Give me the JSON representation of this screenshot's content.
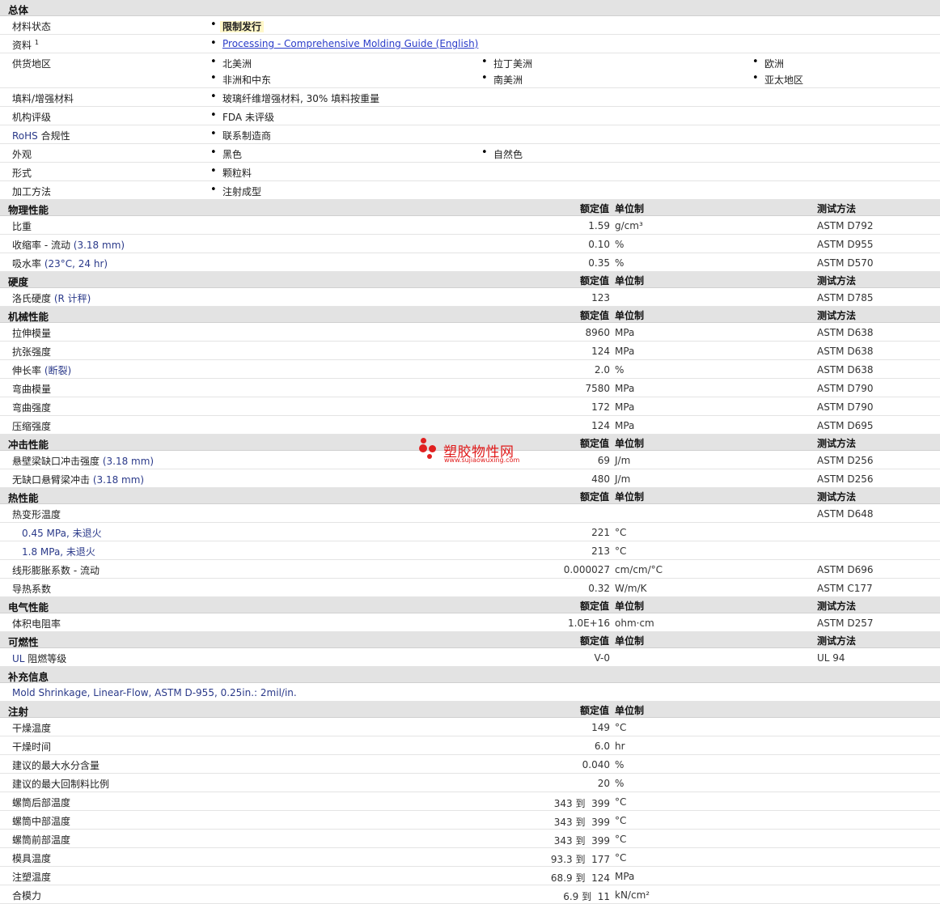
{
  "sections": {
    "overview": {
      "title": "总体"
    },
    "physical": {
      "title": "物理性能",
      "h_value": "额定值",
      "h_unit": "单位制",
      "h_test": "测试方法"
    },
    "hardness": {
      "title": "硬度",
      "h_value": "额定值",
      "h_unit": "单位制",
      "h_test": "测试方法"
    },
    "mechanical": {
      "title": "机械性能",
      "h_value": "额定值",
      "h_unit": "单位制",
      "h_test": "测试方法"
    },
    "impact": {
      "title": "冲击性能",
      "h_value": "额定值",
      "h_unit": "单位制",
      "h_test": "测试方法"
    },
    "thermal": {
      "title": "热性能",
      "h_value": "额定值",
      "h_unit": "单位制",
      "h_test": "测试方法"
    },
    "electrical": {
      "title": "电气性能",
      "h_value": "额定值",
      "h_unit": "单位制",
      "h_test": "测试方法"
    },
    "flammability": {
      "title": "可燃性",
      "h_value": "额定值",
      "h_unit": "单位制",
      "h_test": "测试方法"
    },
    "supplemental": {
      "title": "补充信息"
    },
    "injection": {
      "title": "注射",
      "h_value": "额定值",
      "h_unit": "单位制"
    }
  },
  "overview": {
    "material_status": {
      "label": "材料状态",
      "value": "限制发行"
    },
    "literature": {
      "label": "资料",
      "sup": "1",
      "link": "Processing - Comprehensive Molding Guide (English)"
    },
    "availability": {
      "label": "供货地区",
      "items": [
        "北美洲",
        "拉丁美洲",
        "欧洲",
        "非洲和中东",
        "南美洲",
        "亚太地区"
      ]
    },
    "filler": {
      "label": "填料/增强材料",
      "value": "玻璃纤维增强材料, 30% 填料按重量"
    },
    "agency": {
      "label": "机构评级",
      "value": "FDA 未评级"
    },
    "rohs": {
      "label_en": "RoHS",
      "label_zh": " 合规性",
      "value": "联系制造商"
    },
    "appearance": {
      "label": "外观",
      "items": [
        "黑色",
        "自然色"
      ]
    },
    "form": {
      "label": "形式",
      "value": "颗粒料"
    },
    "processing": {
      "label": "加工方法",
      "value": "注射成型"
    }
  },
  "physical": [
    {
      "label": "比重",
      "qual": "",
      "value": "1.59",
      "unit": "g/cm³",
      "test": "ASTM D792"
    },
    {
      "label": "收缩率 - 流动",
      "qual": " (3.18 mm)",
      "value": "0.10",
      "unit": "%",
      "test": "ASTM D955"
    },
    {
      "label": "吸水率",
      "qual": " (23°C, 24 hr)",
      "value": "0.35",
      "unit": "%",
      "test": "ASTM D570"
    }
  ],
  "hardness": [
    {
      "label": "洛氏硬度",
      "qual": " (R 计秤)",
      "value": "123",
      "unit": "",
      "test": "ASTM D785"
    }
  ],
  "mechanical": [
    {
      "label": "拉伸模量",
      "qual": "",
      "value": "8960",
      "unit": "MPa",
      "test": "ASTM D638"
    },
    {
      "label": "抗张强度",
      "qual": "",
      "value": "124",
      "unit": "MPa",
      "test": "ASTM D638"
    },
    {
      "label": "伸长率",
      "qual": " (断裂)",
      "value": "2.0",
      "unit": "%",
      "test": "ASTM D638"
    },
    {
      "label": "弯曲模量",
      "qual": "",
      "value": "7580",
      "unit": "MPa",
      "test": "ASTM D790"
    },
    {
      "label": "弯曲强度",
      "qual": "",
      "value": "172",
      "unit": "MPa",
      "test": "ASTM D790"
    },
    {
      "label": "压缩强度",
      "qual": "",
      "value": "124",
      "unit": "MPa",
      "test": "ASTM D695"
    }
  ],
  "impact": [
    {
      "label": "悬壁梁缺口冲击强度",
      "qual": " (3.18 mm)",
      "value": "69",
      "unit": "J/m",
      "test": "ASTM D256"
    },
    {
      "label": "无缺口悬臂梁冲击",
      "qual": " (3.18 mm)",
      "value": "480",
      "unit": "J/m",
      "test": "ASTM D256"
    }
  ],
  "thermal": {
    "hdt": {
      "label": "热变形温度",
      "test": "ASTM D648"
    },
    "hdt_045": {
      "label": "0.45 MPa, 未退火",
      "value": "221",
      "unit": "°C"
    },
    "hdt_18": {
      "label": "1.8 MPa, 未退火",
      "value": "213",
      "unit": "°C"
    },
    "clte": {
      "label": "线形膨胀系数 - 流动",
      "value": "0.000027",
      "unit": "cm/cm/°C",
      "test": "ASTM D696"
    },
    "tc": {
      "label": "导热系数",
      "value": "0.32",
      "unit": "W/m/K",
      "test": "ASTM C177"
    }
  },
  "electrical": [
    {
      "label": "体积电阻率",
      "qual": "",
      "value": "1.0E+16",
      "unit": "ohm·cm",
      "test": "ASTM D257"
    }
  ],
  "flammability": {
    "label_en": "UL",
    "label_zh": " 阻燃等级",
    "value": "V-0",
    "unit": "",
    "test": "UL 94"
  },
  "supplemental": {
    "note": "Mold Shrinkage, Linear-Flow, ASTM D-955, 0.25in.: 2mil/in."
  },
  "injection": [
    {
      "label": "干燥温度",
      "value": "149",
      "unit": "°C"
    },
    {
      "label": "干燥时间",
      "value": "6.0",
      "unit": "hr"
    },
    {
      "label": "建议的最大水分含量",
      "value": "0.040",
      "unit": "%"
    },
    {
      "label": "建议的最大回制料比例",
      "value": "20",
      "unit": "%"
    },
    {
      "label": "螺筒后部温度",
      "value": "343 到  399",
      "unit": "°C"
    },
    {
      "label": "螺筒中部温度",
      "value": "343 到  399",
      "unit": "°C"
    },
    {
      "label": "螺筒前部温度",
      "value": "343 到  399",
      "unit": "°C"
    },
    {
      "label": "模具温度",
      "value": "93.3 到  177",
      "unit": "°C"
    },
    {
      "label": "注塑温度",
      "value": "68.9 到  124",
      "unit": "MPa"
    },
    {
      "label": "合模力",
      "value": "6.9 到  11",
      "unit": "kN/cm²"
    }
  ],
  "watermark": {
    "name": "塑胶物性网",
    "url": "www.sujiaowuxing.com",
    "color": "#e01a1a"
  }
}
